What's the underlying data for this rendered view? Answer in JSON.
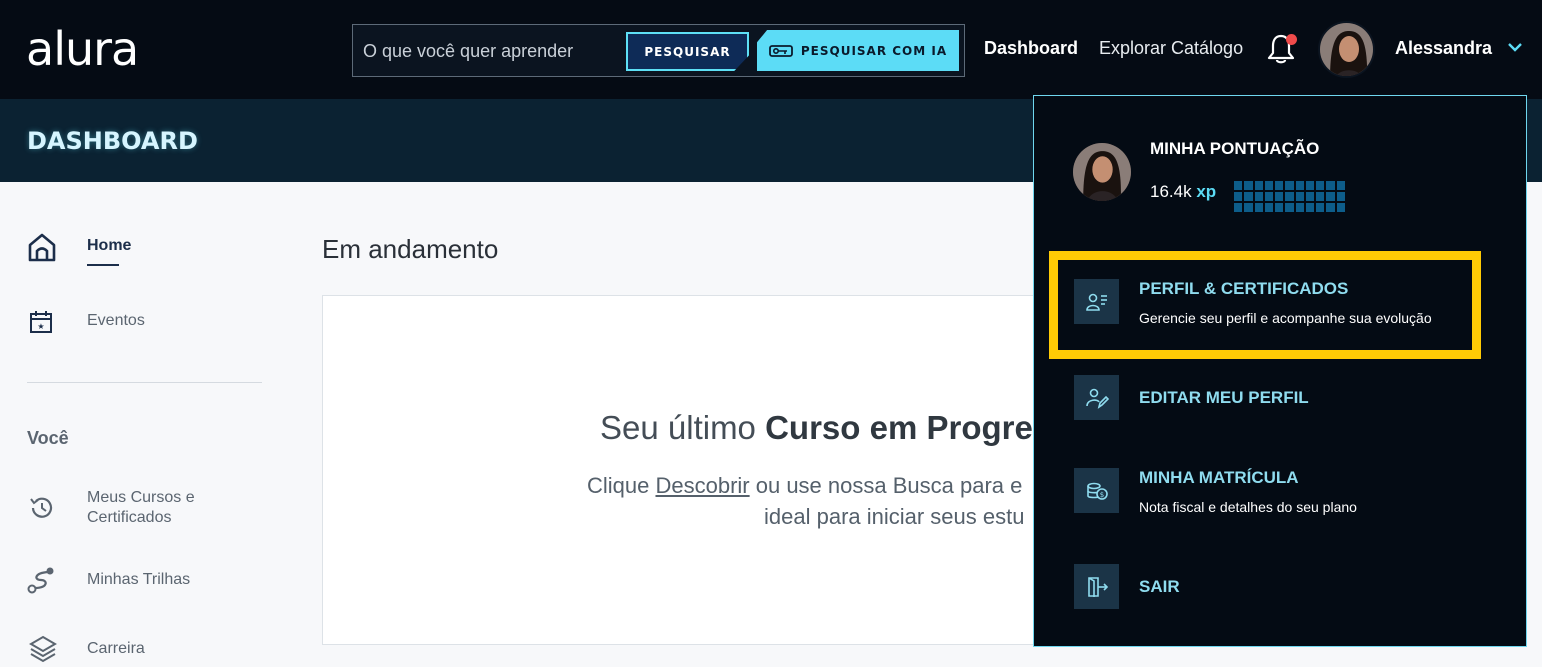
{
  "header": {
    "logo": "alura",
    "search": {
      "placeholder": "O que você quer aprender",
      "button_label": "PESQUISAR",
      "ai_button_label": "PESQUISAR COM IA"
    },
    "nav": {
      "dashboard": "Dashboard",
      "catalog": "Explorar Catálogo"
    },
    "user": {
      "name": "Alessandra"
    }
  },
  "banner": {
    "title": "DASHBOARD"
  },
  "sidebar": {
    "items": [
      {
        "label": "Home",
        "icon": "home-icon"
      },
      {
        "label": "Eventos",
        "icon": "calendar-icon"
      }
    ],
    "section_title": "Você",
    "section_items": [
      {
        "label": "Meus Cursos e Certificados",
        "line1": "Meus Cursos e",
        "line2": "Certificados",
        "icon": "history-icon"
      },
      {
        "label": "Minhas Trilhas",
        "icon": "route-icon"
      },
      {
        "label": "Carreira",
        "icon": "layers-icon"
      }
    ]
  },
  "main": {
    "title": "Em andamento",
    "card": {
      "heading_normal": "Seu último ",
      "heading_bold": "Curso em Progre",
      "line1_prefix": "Clique ",
      "line1_link": "Descobrir",
      "line1_suffix": " ou use nossa Busca para e",
      "line2": "ideal para iniciar seus estu"
    }
  },
  "dropdown": {
    "score_title": "MINHA PONTUAÇÃO",
    "xp_value": "16.4k",
    "xp_unit": "xp",
    "items": [
      {
        "title": "PERFIL & CERTIFICADOS",
        "desc": "Gerencie seu perfil e acompanhe sua evolução",
        "icon": "profile-certificate-icon"
      },
      {
        "title": "EDITAR MEU PERFIL",
        "desc": "",
        "icon": "edit-profile-icon"
      },
      {
        "title": "MINHA MATRÍCULA",
        "desc": "Nota fiscal e detalhes do seu plano",
        "icon": "coins-icon"
      },
      {
        "title": "SAIR",
        "desc": "",
        "icon": "logout-icon"
      }
    ]
  },
  "colors": {
    "accent": "#5cdcf6",
    "highlight": "#ffcb05",
    "topbar": "#050b14",
    "notification": "#f04b4b"
  }
}
